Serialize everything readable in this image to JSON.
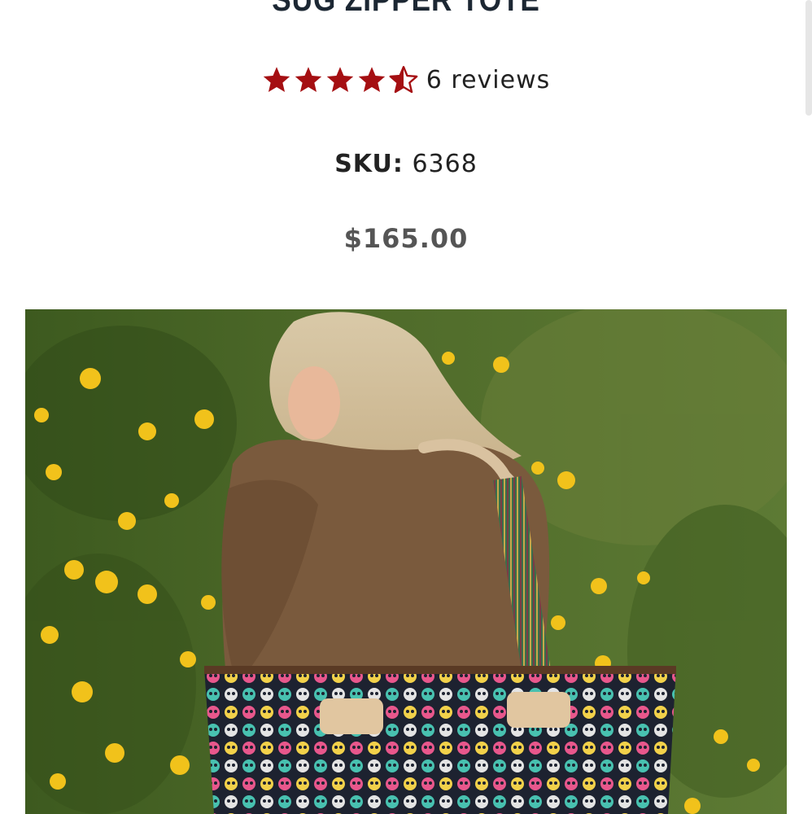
{
  "product": {
    "title": "SUG ZIPPER TOTE",
    "rating": 4.5,
    "rating_max": 5,
    "reviews_label": "6 reviews",
    "sku_label": "SKU:",
    "sku_value": "6368",
    "price": "$165.00"
  },
  "icons": {
    "star": "star-icon",
    "half_star": "half-star-icon"
  },
  "colors": {
    "star": "#a50f12",
    "title": "#1c2733",
    "price": "#555555"
  }
}
